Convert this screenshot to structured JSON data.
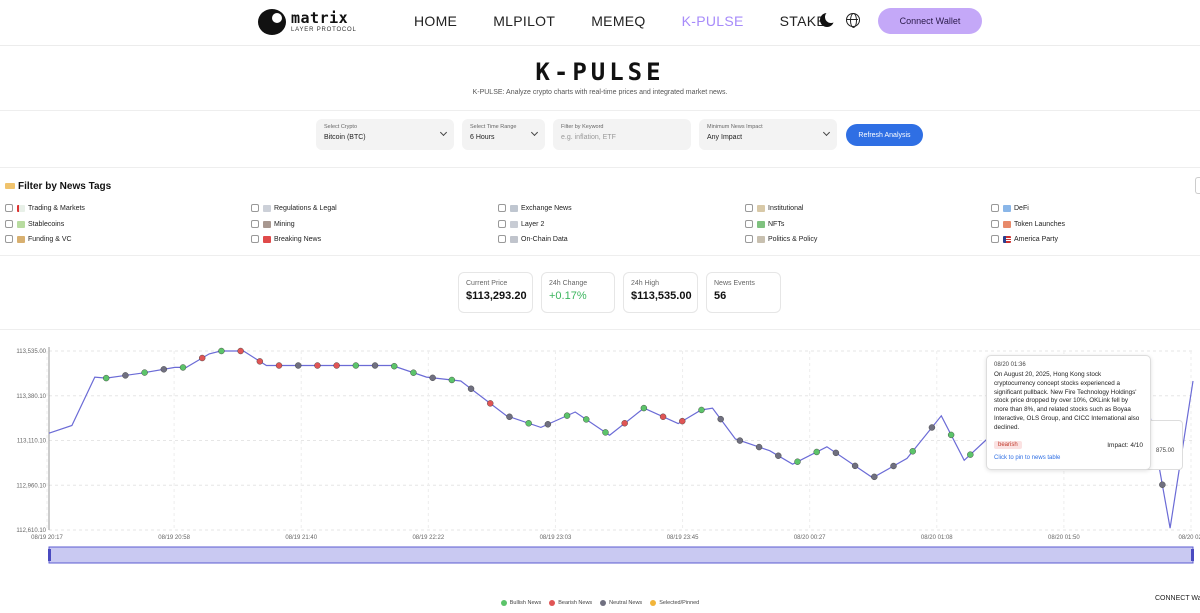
{
  "nav": {
    "logo_name": "matrix",
    "logo_sub": "LAYER PROTOCOL",
    "links": [
      "HOME",
      "MLPILOT",
      "MEMEQ",
      "K-PULSE",
      "STAKE"
    ],
    "active": "K-PULSE",
    "connect_label": "Connect Wallet"
  },
  "header": {
    "title": "K-PULSE",
    "subtitle": "K-PULSE: Analyze crypto charts with real-time prices and integrated market news."
  },
  "controls": {
    "crypto": {
      "label": "Select Crypto",
      "value": "Bitcoin (BTC)"
    },
    "time_range": {
      "label": "Select Time Range",
      "value": "6 Hours"
    },
    "keyword": {
      "label": "Filter by Keyword",
      "placeholder": "e.g. inflation, ETF"
    },
    "impact": {
      "label": "Minimum News Impact",
      "value": "Any Impact"
    },
    "refresh_label": "Refresh Analysis"
  },
  "tags": {
    "title": "Filter by News Tags",
    "items": [
      {
        "label": "Trading & Markets",
        "icon": "chart-up-icon"
      },
      {
        "label": "Regulations & Legal",
        "icon": "scales-icon"
      },
      {
        "label": "Exchange News",
        "icon": "bank-icon"
      },
      {
        "label": "Institutional",
        "icon": "building-icon"
      },
      {
        "label": "DeFi",
        "icon": "swap-icon"
      },
      {
        "label": "Stablecoins",
        "icon": "dollar-bills-icon"
      },
      {
        "label": "Mining",
        "icon": "pickaxe-icon"
      },
      {
        "label": "Layer 2",
        "icon": "link-icon"
      },
      {
        "label": "NFTs",
        "icon": "picture-icon"
      },
      {
        "label": "Token Launches",
        "icon": "rocket-icon"
      },
      {
        "label": "Funding & VC",
        "icon": "money-bag-icon"
      },
      {
        "label": "Breaking News",
        "icon": "siren-icon"
      },
      {
        "label": "On-Chain Data",
        "icon": "chain-icon"
      },
      {
        "label": "Politics & Policy",
        "icon": "classical-building-icon"
      },
      {
        "label": "America Party",
        "icon": "us-flag-icon"
      }
    ]
  },
  "stats": {
    "price": {
      "label": "Current Price",
      "value": "$113,293.20"
    },
    "change": {
      "label": "24h Change",
      "value": "+0.17%"
    },
    "high": {
      "label": "24h High",
      "value": "$113,535.00"
    },
    "events": {
      "label": "News Events",
      "value": "56"
    }
  },
  "chart_data": {
    "type": "line",
    "title": "",
    "xlabel": "",
    "ylabel": "",
    "ylim": [
      112610,
      113535
    ],
    "y_ticks": [
      "113,535.00",
      "113,380.10",
      "113,110.10",
      "112,960.10",
      "112,610.10"
    ],
    "x_ticks": [
      "08/19 20:17",
      "08/19 20:58",
      "08/19 21:40",
      "08/19 22:22",
      "08/19 23:03",
      "08/19 23:45",
      "08/20 00:27",
      "08/20 01:08",
      "08/20 01:50",
      "08/20 02:"
    ],
    "series": [
      {
        "x": [
          0,
          2,
          4,
          5,
          8,
          11,
          12,
          14,
          15,
          17,
          19,
          23,
          27,
          30,
          33,
          36,
          40,
          43,
          46,
          49,
          52,
          55,
          57,
          58,
          60,
          63,
          65,
          68,
          71,
          72,
          75,
          78,
          80,
          82,
          84,
          86,
          88,
          90,
          92,
          94,
          96,
          98,
          100
        ],
        "y": [
          113110,
          113150,
          113400,
          113395,
          113420,
          113450,
          113450,
          113520,
          113535,
          113535,
          113460,
          113460,
          113460,
          113460,
          113400,
          113380,
          113200,
          113140,
          113220,
          113100,
          113240,
          113160,
          113230,
          113240,
          113080,
          113020,
          112950,
          113040,
          112920,
          112880,
          112980,
          113200,
          112970,
          113080,
          113180,
          113230,
          113280,
          113330,
          113320,
          113380,
          113280,
          112620,
          113380
        ]
      }
    ],
    "event_markers": {
      "bullish": 23,
      "bearish": 13,
      "neutral": 20
    },
    "legend": [
      "Bullish News",
      "Bearish News",
      "Neutral News",
      "Selected/Pinned"
    ],
    "legend_position": "bottom",
    "colors": {
      "line": "#6b6bd6",
      "bullish": "#5cc46a",
      "bearish": "#e05555",
      "neutral": "#707080",
      "pinned": "#f2b53a"
    }
  },
  "tooltip": {
    "time": "08/20 01:36",
    "text": "On August 20, 2025, Hong Kong stock cryptocurrency concept stocks experienced a significant pullback. New Fire Technology Holdings' stock price dropped by over 10%, OKLink fell by more than 8%, and related stocks such as Boyaa Interactive, OLS Group, and CICC International also declined.",
    "sentiment": "bearish",
    "impact": "Impact: 4/10",
    "link": "Click to pin to news table",
    "behind_value": "875.00"
  },
  "footer": {
    "connect_partial": "CONNECT Wa"
  }
}
